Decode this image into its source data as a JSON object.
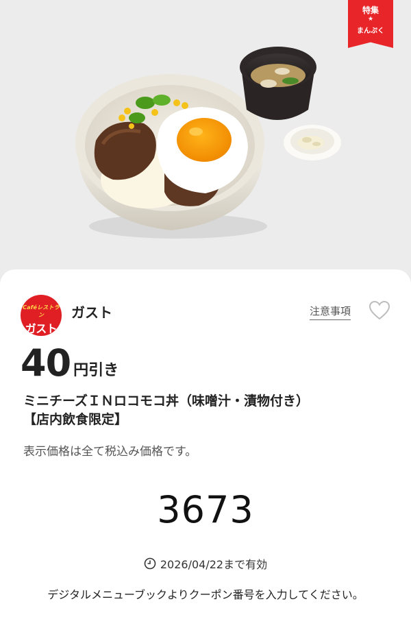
{
  "banner": {
    "ribbon_line1": "特集",
    "ribbon_star": "★",
    "ribbon_line2": "まんぷく",
    "accent_color": "#e8262a"
  },
  "shop": {
    "logo_small": "Caféレストラン",
    "logo_name": "ガスト",
    "name": "ガスト",
    "notice_link": "注意事項",
    "favorite_icon": "heart-outline-icon"
  },
  "coupon": {
    "discount_value": "40",
    "discount_unit": "円引き",
    "product_line1": "ミニチーズＩＮロコモコ丼（味噌汁・漬物付き）",
    "product_line2": "【店内飲食限定】",
    "tax_note": "表示価格は全て税込み価格です。",
    "code": "3673",
    "expiry_icon": "clock-icon",
    "expiry": "2026/04/22まで有効",
    "instruction": "デジタルメニューブックよりクーポン番号を入力してください。"
  }
}
